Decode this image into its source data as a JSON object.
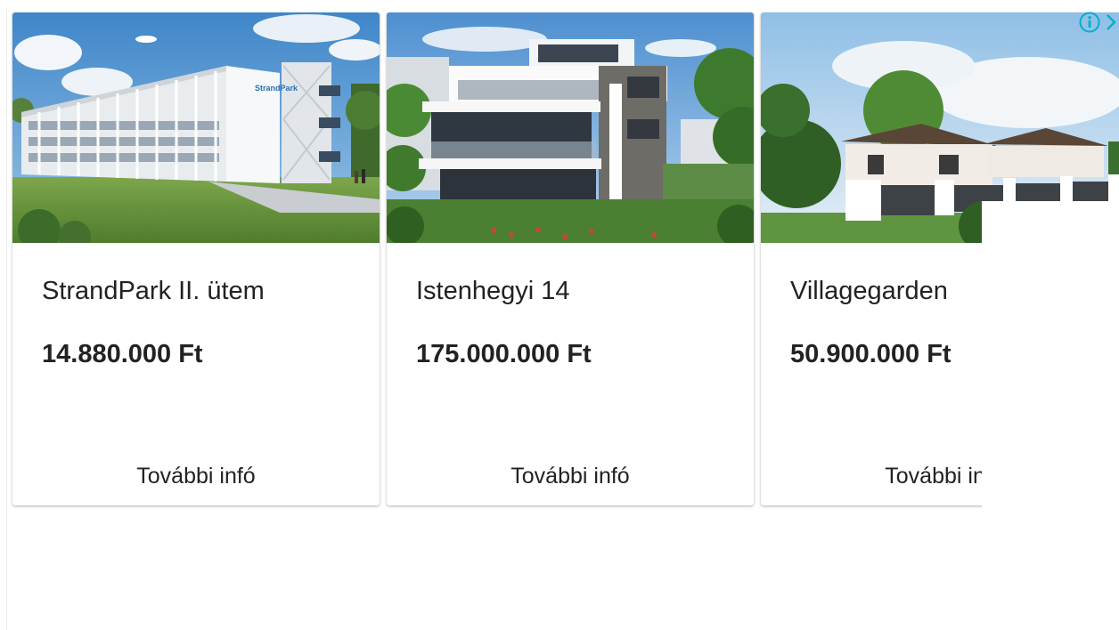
{
  "cards": [
    {
      "title": "StrandPark II. ütem",
      "price": "14.880.000 Ft",
      "cta": "További infó",
      "sign": "StrandPark"
    },
    {
      "title": "Istenhegyi 14",
      "price": "175.000.000 Ft",
      "cta": "További infó"
    },
    {
      "title": "Villagegarden",
      "price": "50.900.000 Ft",
      "cta": "További infó"
    }
  ],
  "ad_controls": {
    "info_icon": "info-icon",
    "close_icon": "chevron-right-icon",
    "accent": "#00aecd"
  }
}
